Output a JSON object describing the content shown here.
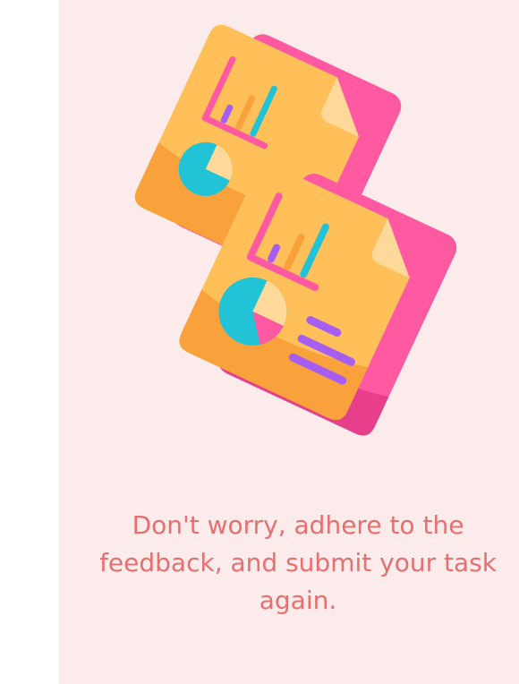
{
  "message": {
    "text": "Don't worry, adhere to the\nfeedback, and submit your task\nagain."
  },
  "illustration": {
    "icon": "report-documents-icon"
  },
  "colors": {
    "panel_bg": "#fbeceb",
    "text": "#e76f70",
    "document_yellow": "#ffc05a",
    "document_orange": "#f9a23b",
    "document_pink": "#ff5aa1",
    "bar_purple": "#a65ef0",
    "bar_cyan": "#22c2d7"
  }
}
